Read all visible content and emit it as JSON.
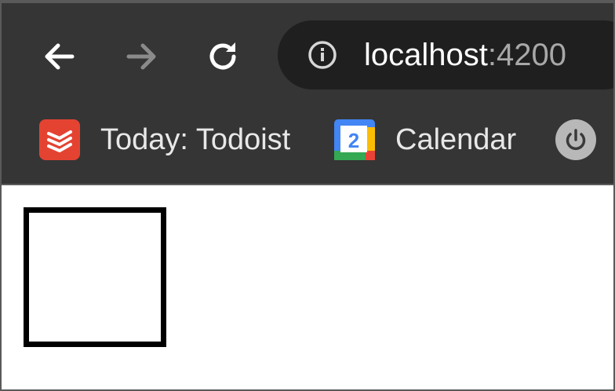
{
  "address_bar": {
    "host": "localhost",
    "port": ":4200"
  },
  "bookmarks": [
    {
      "label": "Today: Todoist",
      "icon": "todoist-icon"
    },
    {
      "label": "Calendar",
      "icon": "google-calendar-icon",
      "icon_text": "2"
    },
    {
      "label": "",
      "icon": "power-icon"
    }
  ],
  "colors": {
    "toolbar_bg": "#353535",
    "omnibox_bg": "#1f1f1f",
    "todoist_red": "#e44332",
    "page_bg": "#ffffff",
    "box_border": "#000000"
  }
}
